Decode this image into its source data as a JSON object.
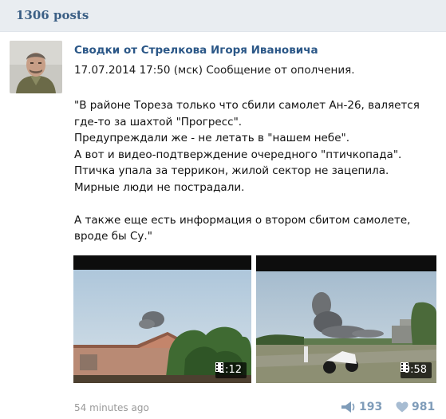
{
  "header": {
    "posts_count": "1306 posts"
  },
  "post": {
    "author": "Сводки от Стрелкова Игоря Ивановича",
    "meta": "17.07.2014 17:50 (мск) Сообщение от ополчения.",
    "text_lines": [
      "\"В районе Тореза только что сбили самолет Ан-26, валяется",
      "где-то за шахтой \"Прогресс\".",
      "Предупреждали же - не летать в \"нашем небе\".",
      "А вот и видео-подтверждение очередного \"птичкопада\".",
      "Птичка упала за террикон, жилой сектор не зацепила.",
      "Мирные люди не пострадали.",
      "",
      "А также еще есть информация о втором сбитом самолете,",
      "вроде бы Су.\""
    ],
    "videos": [
      {
        "duration": "1:12"
      },
      {
        "duration": "0:58"
      }
    ],
    "footer": {
      "time": "54 minutes ago",
      "shares": "193",
      "likes": "981"
    }
  },
  "colors": {
    "header_bg": "#e9edf1",
    "count_text": "#3b5f85",
    "author_link": "#2b5787",
    "muted": "#999999",
    "stat": "#7f9cb9"
  },
  "icons": [
    "film-icon",
    "share-icon",
    "heart-icon"
  ]
}
